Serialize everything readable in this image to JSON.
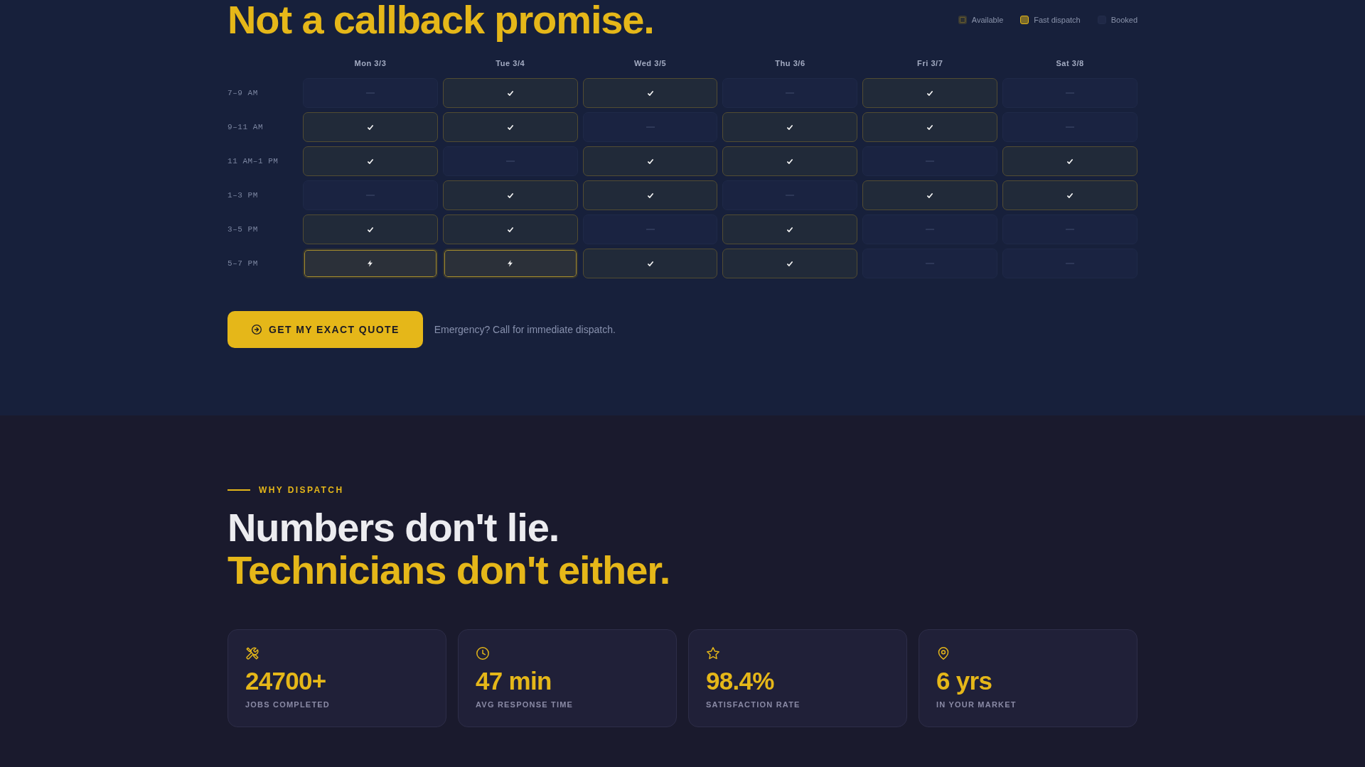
{
  "hero": {
    "heading": "Not a callback promise."
  },
  "legend": [
    {
      "kind": "available",
      "label": "Available"
    },
    {
      "kind": "fast",
      "label": "Fast dispatch"
    },
    {
      "kind": "booked",
      "label": "Booked"
    }
  ],
  "schedule": {
    "days": [
      "Mon 3/3",
      "Tue 3/4",
      "Wed 3/5",
      "Thu 3/6",
      "Fri 3/7",
      "Sat 3/8"
    ],
    "rows": [
      {
        "time": "7–9 AM",
        "slots": [
          {
            "kind": "booked"
          },
          {
            "kind": "available"
          },
          {
            "kind": "available"
          },
          {
            "kind": "booked"
          },
          {
            "kind": "available"
          },
          {
            "kind": "booked"
          }
        ]
      },
      {
        "time": "9–11 AM",
        "slots": [
          {
            "kind": "available"
          },
          {
            "kind": "available"
          },
          {
            "kind": "booked"
          },
          {
            "kind": "available"
          },
          {
            "kind": "available"
          },
          {
            "kind": "booked"
          }
        ]
      },
      {
        "time": "11 AM–1 PM",
        "slots": [
          {
            "kind": "available"
          },
          {
            "kind": "booked"
          },
          {
            "kind": "available"
          },
          {
            "kind": "available"
          },
          {
            "kind": "booked"
          },
          {
            "kind": "available"
          }
        ]
      },
      {
        "time": "1–3 PM",
        "slots": [
          {
            "kind": "booked"
          },
          {
            "kind": "available"
          },
          {
            "kind": "available"
          },
          {
            "kind": "booked"
          },
          {
            "kind": "available"
          },
          {
            "kind": "available"
          }
        ]
      },
      {
        "time": "3–5 PM",
        "slots": [
          {
            "kind": "available"
          },
          {
            "kind": "available"
          },
          {
            "kind": "booked"
          },
          {
            "kind": "available"
          },
          {
            "kind": "booked"
          },
          {
            "kind": "booked"
          }
        ]
      },
      {
        "time": "5–7 PM",
        "slots": [
          {
            "kind": "fast"
          },
          {
            "kind": "fast"
          },
          {
            "kind": "available"
          },
          {
            "kind": "available"
          },
          {
            "kind": "booked"
          },
          {
            "kind": "booked"
          }
        ]
      }
    ]
  },
  "cta": {
    "button": "GET MY EXACT QUOTE",
    "note": "Emergency? Call for immediate dispatch."
  },
  "why": {
    "eyebrow": "WHY DISPATCH",
    "heading_line_1": "Numbers don't lie.",
    "heading_line_2": "Technicians don't either."
  },
  "stats": [
    {
      "kind": "tools",
      "value": "24700+",
      "label": "JOBS COMPLETED"
    },
    {
      "kind": "clock",
      "value": "47 min",
      "label": "AVG RESPONSE TIME"
    },
    {
      "kind": "star",
      "value": "98.4%",
      "label": "SATISFACTION RATE"
    },
    {
      "kind": "pin",
      "value": "6 yrs",
      "label": "IN YOUR MARKET"
    }
  ]
}
